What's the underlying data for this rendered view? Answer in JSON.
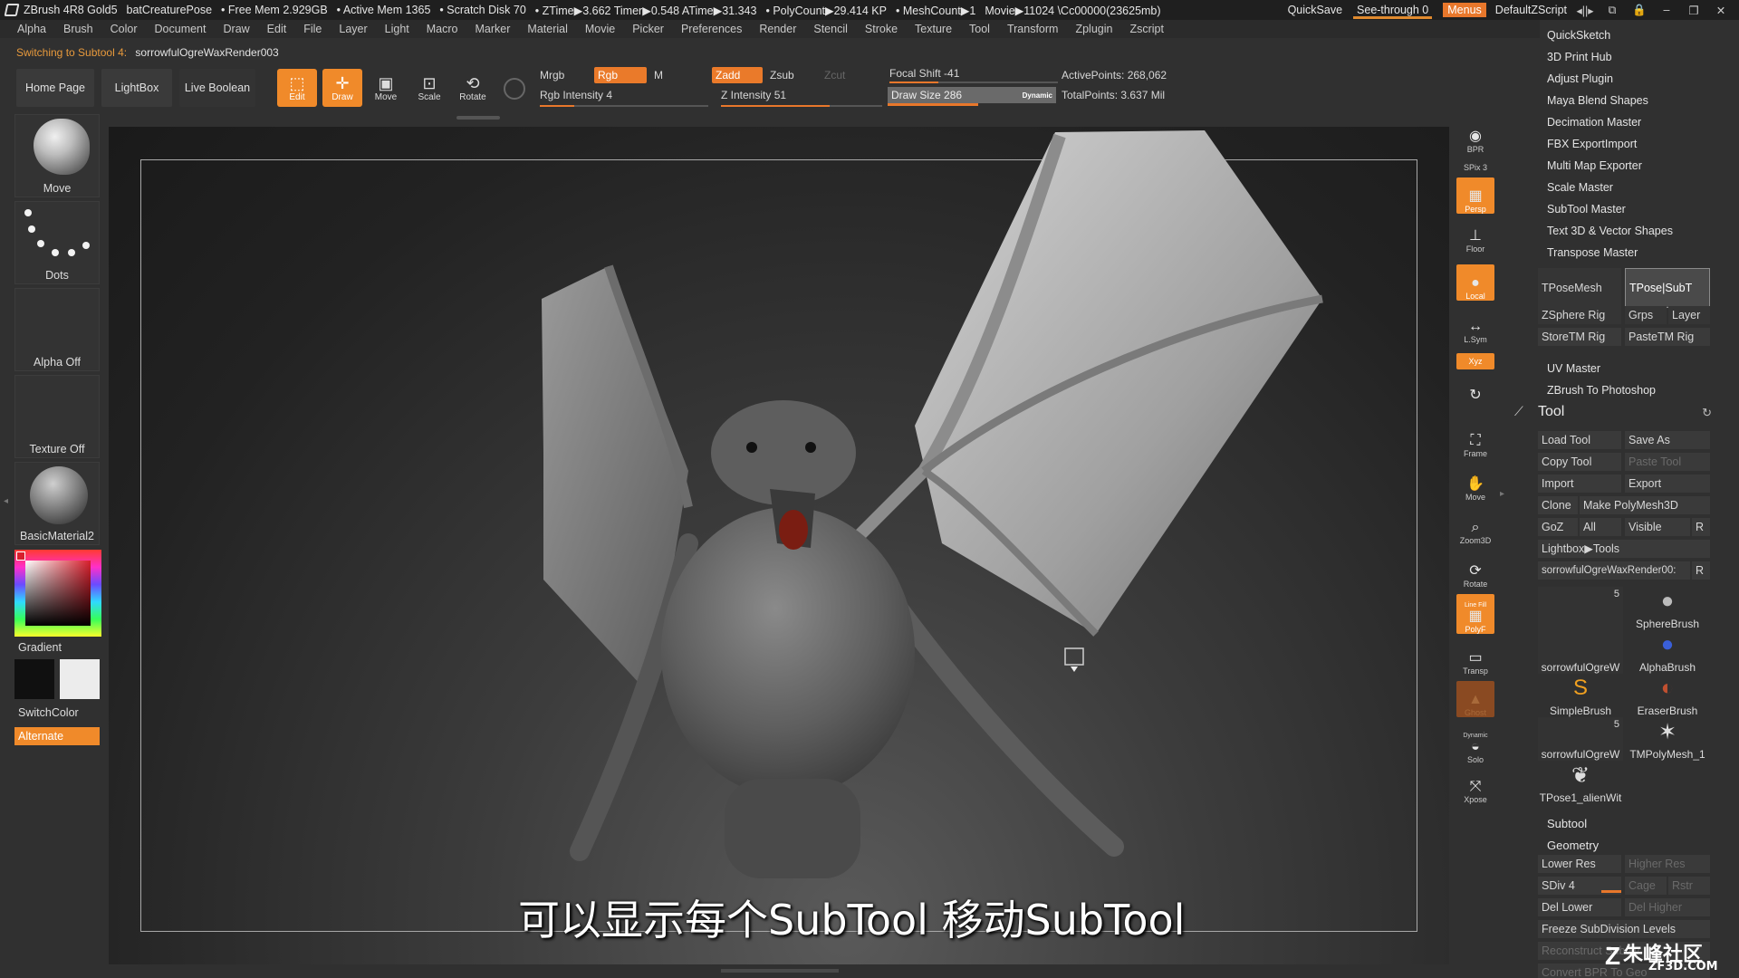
{
  "titlebar": {
    "app": "ZBrush 4R8 Gold5",
    "doc": "batCreaturePose",
    "free_mem": "• Free Mem 2.929GB",
    "active_mem": "• Active Mem 1365",
    "scratch": "• Scratch Disk 70",
    "ztime": "• ZTime▶3.662 Timer▶0.548 ATime▶31.343",
    "polycount": "• PolyCount▶29.414 KP",
    "meshcount": "• MeshCount▶1",
    "movie": "Movie▶11024 \\Cc00000(23625mb)",
    "quicksave": "QuickSave",
    "see_through": "See-through  0",
    "menus": "Menus",
    "script": "DefaultZScript"
  },
  "menubar": [
    "Alpha",
    "Brush",
    "Color",
    "Document",
    "Draw",
    "Edit",
    "File",
    "Layer",
    "Light",
    "Macro",
    "Marker",
    "Material",
    "Movie",
    "Picker",
    "Preferences",
    "Render",
    "Stencil",
    "Stroke",
    "Texture",
    "Tool",
    "Transform",
    "Zplugin",
    "Zscript"
  ],
  "status": {
    "warn": "Switching to Subtool 4:",
    "subtool": "sorrowfulOgreWaxRender003"
  },
  "toolbar": {
    "home": "Home Page",
    "lightbox": "LightBox",
    "live_boolean": "Live Boolean",
    "edit": "Edit",
    "draw": "Draw",
    "move": "Move",
    "scale": "Scale",
    "rotate": "Rotate",
    "mrgb": "Mrgb",
    "rgb": "Rgb",
    "m": "M",
    "rgb_intensity": "Rgb Intensity 4",
    "zadd": "Zadd",
    "zsub": "Zsub",
    "zcut": "Zcut",
    "z_intensity": "Z Intensity 51",
    "focal_shift": "Focal Shift -41",
    "draw_size": "Draw Size 286",
    "dynamic": "Dynamic",
    "active_points": "ActivePoints: 268,062",
    "total_points": "TotalPoints: 3.637 Mil"
  },
  "leftshelf": {
    "move": "Move",
    "dots": "Dots",
    "alpha": "Alpha Off",
    "texture": "Texture Off",
    "material": "BasicMaterial2",
    "gradient": "Gradient",
    "switchcolor": "SwitchColor",
    "alternate": "Alternate"
  },
  "viewport": {
    "subtitle": "可以显示每个SubTool 移动SubTool"
  },
  "rightstrip": {
    "bpr": "BPR",
    "spix": "SPix 3",
    "persp": "Persp",
    "floor": "Floor",
    "local": "Local",
    "lsym": "L.Sym",
    "xyz": "Xyz",
    "frame": "Frame",
    "move": "Move",
    "zoom3d": "Zoom3D",
    "rotate": "Rotate",
    "polyf": "PolyF",
    "linefill": "Line Fill",
    "transp": "Transp",
    "ghost": "Ghost",
    "solo": "Solo",
    "dynamic": "Dynamic",
    "xpose": "Xpose"
  },
  "plugins": [
    "QuickSketch",
    "3D Print Hub",
    "Adjust Plugin",
    "Maya Blend Shapes",
    "Decimation Master",
    "FBX ExportImport",
    "Multi Map Exporter",
    "Scale Master",
    "SubTool Master",
    "Text 3D & Vector Shapes",
    "Transpose Master"
  ],
  "transpose": {
    "tposemesh": "TPoseMesh",
    "tpose_subt": "TPose|SubT",
    "zsphere_rig": "ZSphere Rig",
    "grps": "Grps",
    "layer": "Layer",
    "storetm": "StoreTM Rig",
    "pastetm": "PasteTM Rig"
  },
  "plugins2": [
    "UV Master",
    "ZBrush To Photoshop"
  ],
  "tool": {
    "header": "Tool",
    "load": "Load Tool",
    "save_as": "Save As",
    "copy": "Copy Tool",
    "paste": "Paste Tool",
    "import": "Import",
    "export": "Export",
    "clone": "Clone",
    "make_polymesh": "Make PolyMesh3D",
    "goz": "GoZ",
    "all": "All",
    "visible": "Visible",
    "r": "R",
    "lightbox_tools": "Lightbox▶Tools",
    "current": "sorrowfulOgreWaxRender00:",
    "r2": "R"
  },
  "brushes": [
    {
      "label": "sorrowfulOgreW",
      "badge": "5"
    },
    {
      "label": "SphereBrush"
    },
    {
      "label": "AlphaBrush"
    },
    {
      "label": "SimpleBrush"
    },
    {
      "label": "EraserBrush"
    },
    {
      "label": "sorrowfulOgreW",
      "badge": "5"
    },
    {
      "label": "TMPolyMesh_1"
    },
    {
      "label": "TPose1_alienWit"
    }
  ],
  "subtool": {
    "header": "Subtool",
    "geometry": "Geometry",
    "lower_res": "Lower Res",
    "higher_res": "Higher Res",
    "sdiv": "SDiv 4",
    "cage": "Cage",
    "rstr": "Rstr",
    "del_lower": "Del Lower",
    "del_higher": "Del Higher",
    "freeze": "Freeze SubDivision Levels",
    "reconstruct": "Reconstruct Subdiv",
    "convert_bpr": "Convert BPR To Geo"
  },
  "watermark": {
    "cn": "朱峰社区",
    "url": "ZF3D.COM"
  },
  "colors": {
    "accent": "#f08a2a",
    "panel": "#303030",
    "title": "#1f1f1f"
  }
}
